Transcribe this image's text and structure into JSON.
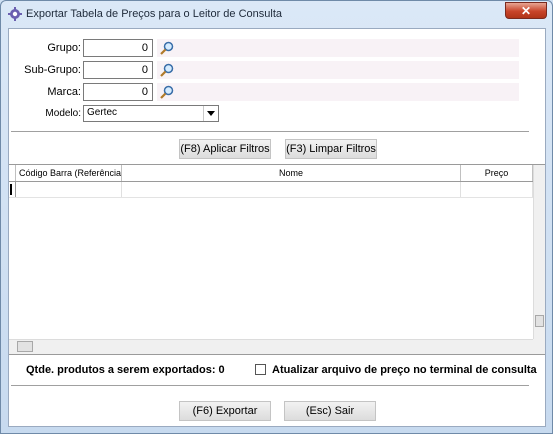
{
  "window": {
    "title": "Exportar Tabela de Preços para o Leitor de Consulta",
    "close_label": "✕"
  },
  "filters": [
    {
      "label": "Grupo:",
      "value": "0"
    },
    {
      "label": "Sub-Grupo:",
      "value": "0"
    },
    {
      "label": "Marca:",
      "value": "0"
    }
  ],
  "modelo": {
    "label": "Modelo:",
    "value": "Gertec"
  },
  "buttons": {
    "apply": "(F8) Aplicar Filtros",
    "clear": "(F3) Limpar Filtros",
    "export": "(F6) Exportar",
    "exit": "(Esc) Sair"
  },
  "grid": {
    "columns": [
      "Código Barra (Referência)",
      "Nome",
      "Preço"
    ]
  },
  "footer": {
    "count_text": "Qtde. produtos a serem exportados: 0",
    "checkbox_label": "Atualizar arquivo de preço no terminal de consulta",
    "checkbox_checked": false
  },
  "icons": {
    "app": "settings-gear-icon",
    "search": "magnifier-icon"
  }
}
